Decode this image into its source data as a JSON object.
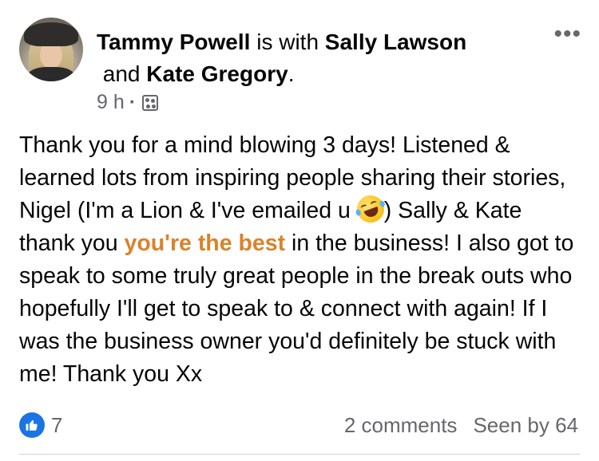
{
  "post": {
    "author": "Tammy Powell",
    "with_text": " is with ",
    "tagged_1": "Sally Lawson",
    "and_text": " and ",
    "tagged_2": "Kate Gregory",
    "period": ".",
    "time": "9 h",
    "separator": "·",
    "audience_icon": "custom-audience-icon",
    "more_options": "•••",
    "body": {
      "part1": "Thank you for a mind blowing 3 days! Listened & learned lots from inspiring people sharing their stories, Nigel (I'm a Lion & I've emailed u ",
      "emoji": "rolling-on-floor-laughing-emoji",
      "part2": ") Sally & Kate thank you ",
      "highlight": "you're the best",
      "part3": " in the business! I also got to speak to some truly great people in the break outs who hopefully I'll get to speak to & connect with again! If I was the business owner you'd definitely be stuck with me! Thank you Xx"
    }
  },
  "reactions": {
    "icon": "like-icon",
    "count": "7",
    "comments": "2 comments",
    "seen_by": "Seen by 64"
  },
  "colors": {
    "accent_blue": "#1b74e4",
    "highlight_orange": "#d9832b",
    "secondary_text": "#65676b"
  }
}
